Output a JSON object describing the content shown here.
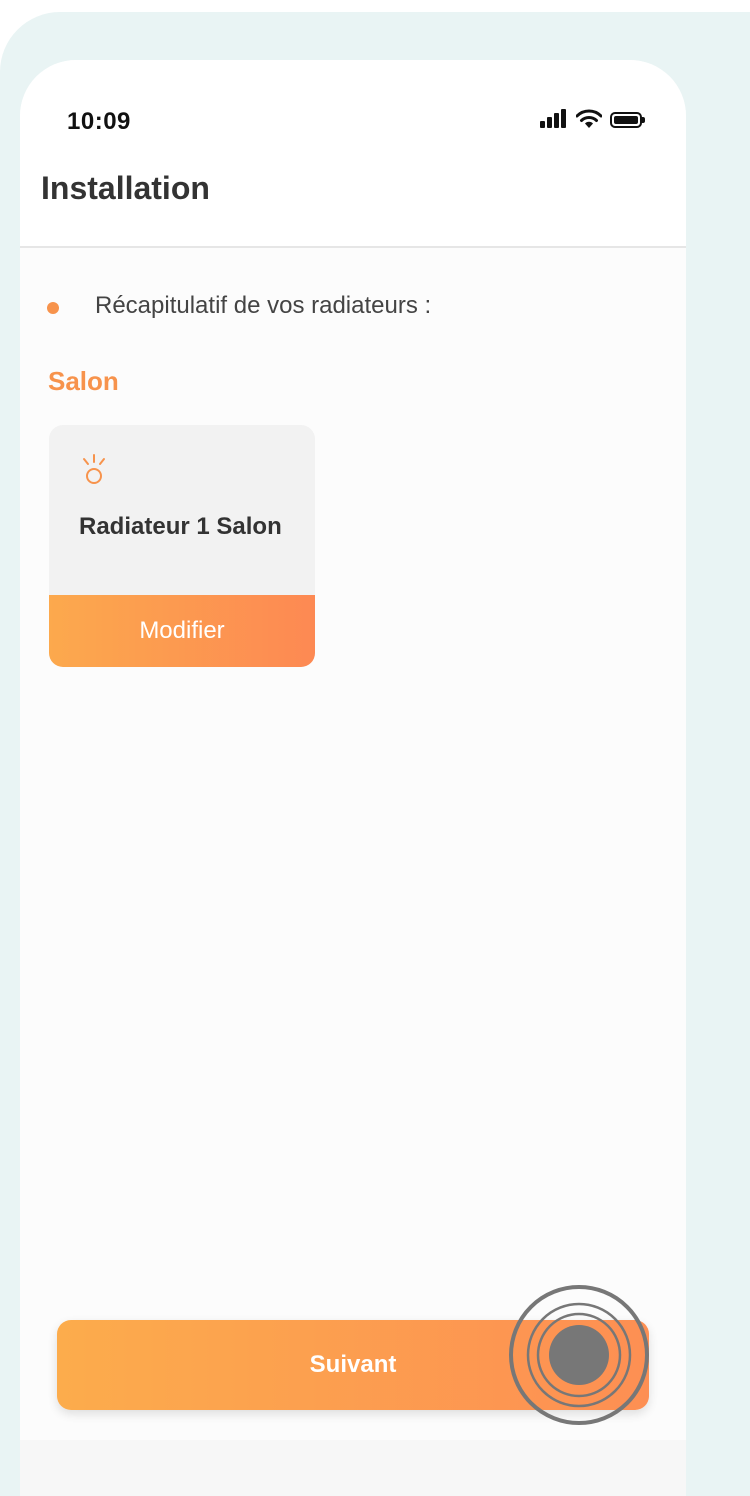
{
  "status_bar": {
    "time": "10:09",
    "icons": [
      "signal-icon",
      "wifi-icon",
      "battery-icon"
    ]
  },
  "header": {
    "title": "Installation"
  },
  "summary": {
    "text": "Récapitulatif de vos radiateurs :"
  },
  "rooms": [
    {
      "name": "Salon",
      "devices": [
        {
          "icon": "bulb-icon",
          "name": "Radiateur 1 Salon",
          "action_label": "Modifier"
        }
      ]
    }
  ],
  "footer": {
    "next_label": "Suivant"
  },
  "colors": {
    "accent": "#f7934c",
    "gradient_start": "#fcac4c",
    "gradient_end": "#fd8953",
    "background_panel": "#e9f4f4",
    "tap_indicator": "#777777"
  }
}
